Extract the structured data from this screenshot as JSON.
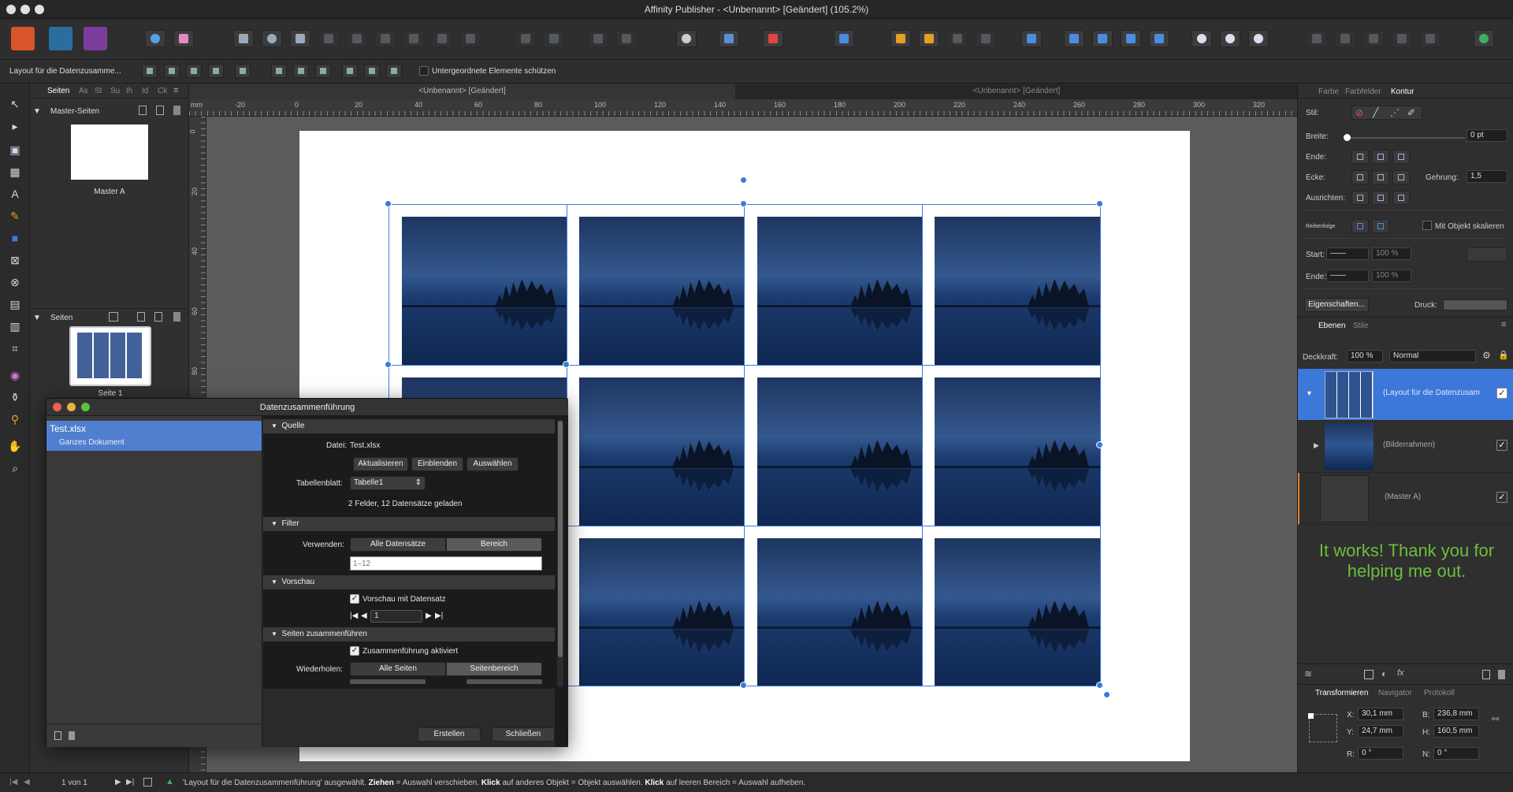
{
  "window": {
    "title": "Affinity Publisher - <Unbenannt> [Geändert] (105.2%)"
  },
  "context": {
    "selection_label": "Layout für die Datenzusamme...",
    "protect_label": "Untergeordnete Elemente schützen"
  },
  "left_panel": {
    "tabs": [
      "Seiten",
      "As",
      "St",
      "Su",
      "Ih",
      "Id",
      "Ck"
    ],
    "master_section": "Master-Seiten",
    "master_name": "Master A",
    "pages_section": "Seiten",
    "page_name": "Seite 1"
  },
  "doc_tabs": [
    "<Unbenannt> [Geändert]",
    "<Unbenannt> [Geändert]"
  ],
  "ruler": {
    "unit": "mm",
    "h_ticks": [
      "-20",
      "0",
      "20",
      "40",
      "60",
      "80",
      "100",
      "120",
      "140",
      "160",
      "180",
      "200",
      "220",
      "240",
      "260",
      "280",
      "300",
      "320"
    ],
    "v_ticks": [
      "0",
      "20",
      "40",
      "60",
      "80"
    ]
  },
  "right_panel": {
    "tabs": [
      "Farbe",
      "Farbfelder",
      "Kontur"
    ],
    "stil_label": "Stil:",
    "breite_label": "Breite:",
    "breite_value": "0 pt",
    "ende_label": "Ende:",
    "ecke_label": "Ecke:",
    "gehrung_label": "Gehrung:",
    "gehrung_value": "1,5",
    "ausrichten_label": "Ausrichten:",
    "reihenfolge_label": "Reihenfolge",
    "mit_objekt_label": "Mit Objekt skalieren",
    "start_label": "Start:",
    "ende2_label": "Ende:",
    "pct1": "100 %",
    "pct2": "100 %",
    "eigenschaften_label": "Eigenschaften...",
    "druck_label": "Druck:",
    "layer_tabs": [
      "Ebenen",
      "Stile"
    ],
    "deckkraft_label": "Deckkraft:",
    "deckkraft_value": "100 %",
    "blend_mode": "Normal",
    "layers": [
      "(Layout für die Datenzusam",
      "(Bilderrahmen)",
      "(Master A)"
    ],
    "note": "It works! Thank you for helping me out.",
    "transform_tabs": [
      "Transformieren",
      "Navigator",
      "Protokoll"
    ],
    "x_label": "X:",
    "x_value": "30,1 mm",
    "y_label": "Y:",
    "y_value": "24,7 mm",
    "b_label": "B:",
    "b_value": "236,8 mm",
    "h_label": "H:",
    "h_value": "160,5 mm",
    "r_label": "R:",
    "r_value": "0 °",
    "n_label": "N:",
    "n_value": "0 °"
  },
  "dialog": {
    "title": "Datenzusammenführung",
    "file_name": "Test.xlsx",
    "file_sub": "Ganzes Dokument",
    "quelle": "Quelle",
    "datei_label": "Datei:",
    "datei_value": "Test.xlsx",
    "btn_aktualisieren": "Aktualisieren",
    "btn_einblenden": "Einblenden",
    "btn_auswaehlen": "Auswählen",
    "tabellenblatt_label": "Tabellenblatt:",
    "tabellenblatt_value": "Tabelle1",
    "info": "2 Felder, 12 Datensätze geladen",
    "filter": "Filter",
    "verwenden_label": "Verwenden:",
    "seg_alle": "Alle Datensätze",
    "seg_bereich": "Bereich",
    "range_placeholder": "1–12",
    "vorschau": "Vorschau",
    "vorschau_check": "Vorschau mit Datensatz",
    "record_value": "1",
    "seiten_section": "Seiten zusammenführen",
    "merge_check": "Zusammenführung aktiviert",
    "wiederholen_label": "Wiederholen:",
    "seg_alle_seiten": "Alle Seiten",
    "seg_seitenbereich": "Seitenbereich",
    "btn_erstellen": "Erstellen",
    "btn_schliessen": "Schließen"
  },
  "status": {
    "page_of": "1 von 1",
    "pre": "'Layout für die Datenzusammenführung' ausgewählt. ",
    "k1": "Ziehen",
    "t1": " = Auswahl verschieben. ",
    "k2": "Klick",
    "t2": " auf anderes Objekt = Objekt auswählen. ",
    "k3": "Klick",
    "t3": " auf leeren Bereich = Auswahl aufheben."
  },
  "colors": {
    "accent": "#3d7bd9",
    "note": "#6bbf3a",
    "selected_layer": "#3c78d8"
  }
}
